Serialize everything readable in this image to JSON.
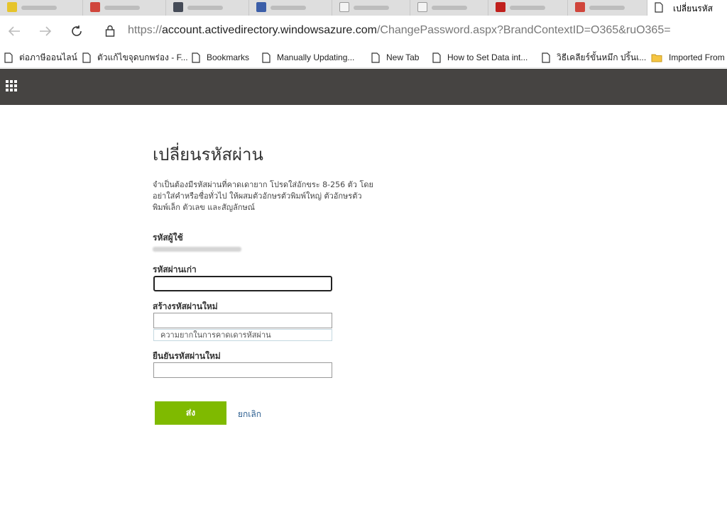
{
  "browser": {
    "active_tab_title": "เปลี่ยนรหัส",
    "url_scheme": "https://",
    "url_host": "account.activedirectory.windowsazure.com",
    "url_path": "/ChangePassword.aspx?BrandContextID=O365&ruO365=",
    "bookmarks": [
      {
        "label": "ต่อภาษีออนไลน์",
        "icon": "page-icon"
      },
      {
        "label": "ตัวแก้ไขจุดบกพร่อง - F...",
        "icon": "page-icon"
      },
      {
        "label": "Bookmarks",
        "icon": "page-icon"
      },
      {
        "label": "Manually Updating...",
        "icon": "page-icon"
      },
      {
        "label": "New Tab",
        "icon": "page-icon"
      },
      {
        "label": "How to Set Data int...",
        "icon": "page-icon"
      },
      {
        "label": "วิธีเคลียร์ขั้นหมึก ปริ้นเ...",
        "icon": "page-icon"
      },
      {
        "label": "Imported From",
        "icon": "folder-icon"
      }
    ]
  },
  "form": {
    "title": "เปลี่ยนรหัสผ่าน",
    "description_lines": [
      "จำเป็นต้องมีรหัสผ่านที่คาดเดายาก โปรดใส่อักขระ 8-256 ตัว โดย",
      "อย่าใส่คำหรือชื่อทั่วไป ให้ผสมตัวอักษรตัวพิมพ์ใหญ่ ตัวอักษรตัว",
      "พิมพ์เล็ก ตัวเลข และสัญลักษณ์"
    ],
    "user_id_label": "รหัสผู้ใช้",
    "old_password_label": "รหัสผ่านเก่า",
    "new_password_label": "สร้างรหัสผ่านใหม่",
    "strength_text": "ความยากในการคาดเดารหัสผ่าน",
    "confirm_password_label": "ยืนยันรหัสผ่านใหม่",
    "submit_label": "ส่ง",
    "cancel_label": "ยกเลิก"
  },
  "colors": {
    "appbar": "#464442",
    "submit": "#7fba00",
    "link": "#2a5d8f"
  }
}
